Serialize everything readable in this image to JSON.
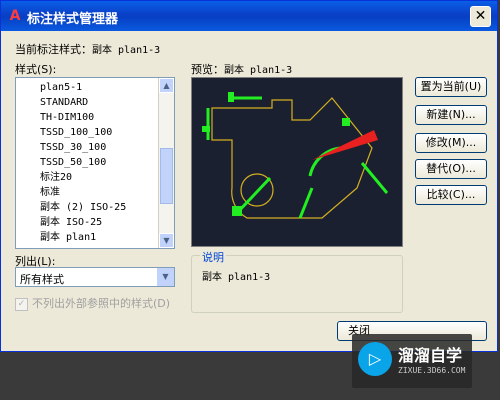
{
  "window": {
    "title": "标注样式管理器",
    "close_glyph": "✕",
    "icon_glyph": "A"
  },
  "labels": {
    "current_style_label": "当前标注样式：",
    "current_style_value": "副本 plan1-3",
    "styles": "样式(S):",
    "preview_label": "预览：",
    "preview_value": "副本 plan1-3",
    "list_label": "列出(L):",
    "description": "说明",
    "description_text": "副本 plan1-3",
    "exclude_xref": "不列出外部参照中的样式(D)"
  },
  "styles_list": [
    "plan5-1",
    "STANDARD",
    "TH-DIM100",
    "TSSD_100_100",
    "TSSD_30_100",
    "TSSD_50_100",
    "标注20",
    "标准",
    "副本 (2) ISO-25",
    "副本 ISO-25",
    "副本 plan1"
  ],
  "list_filter": {
    "value": "所有样式"
  },
  "buttons": {
    "set_current": "置为当前(U)",
    "new": "新建(N)...",
    "modify": "修改(M)...",
    "override": "替代(O)...",
    "compare": "比较(C)...",
    "close": "关闭"
  },
  "watermark": {
    "name": "溜溜自学",
    "url": "ZIXUE.3D66.COM",
    "logo_glyph": "▷"
  },
  "colors": {
    "accent": "#0a40c8",
    "preview_bg": "#1a2030",
    "dim_green": "#22ee22",
    "geometry_yellow": "#d4b020",
    "arrow_red": "#e82020"
  }
}
